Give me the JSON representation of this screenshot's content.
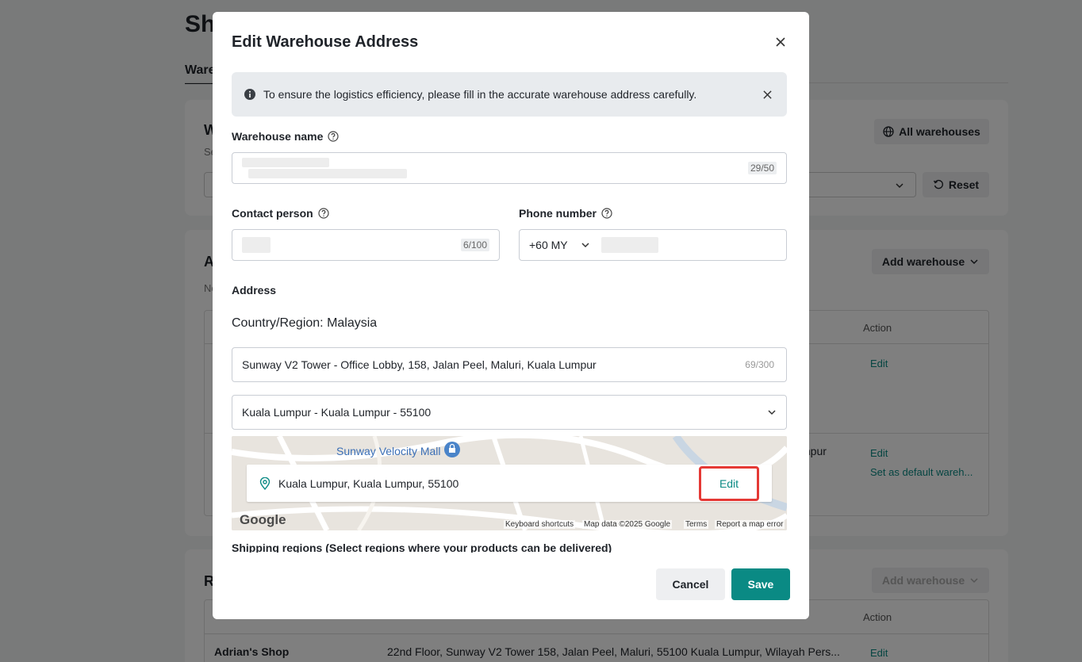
{
  "background": {
    "page_title": "Sh",
    "tab_label": "Ware",
    "card1": {
      "heading": "W",
      "sub": "Se",
      "all_warehouses_label": "All warehouses",
      "reset_label": "Reset"
    },
    "card2": {
      "heading": "A",
      "sub": "No",
      "add_warehouse_label": "Add warehouse",
      "action_header": "Action",
      "edit_label": "Edit",
      "set_default_label": "Set as default wareh...",
      "address_fragment": "mpur"
    },
    "card3": {
      "heading": "R",
      "add_warehouse_label": "Add warehouse",
      "action_header": "Action",
      "row": {
        "name": "Adrian's Shop",
        "address": "22nd Floor, Sunway V2 Tower 158, Jalan Peel, Maluri, 55100 Kuala Lumpur, Wilayah Pers...",
        "action": "Edit"
      }
    }
  },
  "modal": {
    "title": "Edit Warehouse Address",
    "notice": "To ensure the logistics efficiency, please fill in the accurate warehouse address carefully.",
    "warehouse_name": {
      "label": "Warehouse name",
      "counter": "29/50"
    },
    "contact_person": {
      "label": "Contact person",
      "counter": "6/100"
    },
    "phone_number": {
      "label": "Phone number",
      "country_code": "+60 MY"
    },
    "address": {
      "label": "Address",
      "country": "Country/Region: Malaysia",
      "detail": "Sunway V2 Tower - Office Lobby, 158, Jalan Peel, Maluri, Kuala Lumpur",
      "detail_counter": "69/300",
      "region": "Kuala Lumpur - Kuala Lumpur - 55100"
    },
    "map": {
      "poi": "Sunway Velocity Mall",
      "pin_text": "Kuala Lumpur, Kuala Lumpur, 55100",
      "edit_label": "Edit",
      "google": "Google",
      "keyboard": "Keyboard shortcuts",
      "mapdata": "Map data ©2025 Google",
      "terms": "Terms",
      "report": "Report a map error"
    },
    "shipping_label": "Shipping regions (Select regions where your products can be delivered)",
    "cancel_label": "Cancel",
    "save_label": "Save"
  },
  "colors": {
    "accent": "#0a8a84",
    "highlight": "#e53935"
  }
}
